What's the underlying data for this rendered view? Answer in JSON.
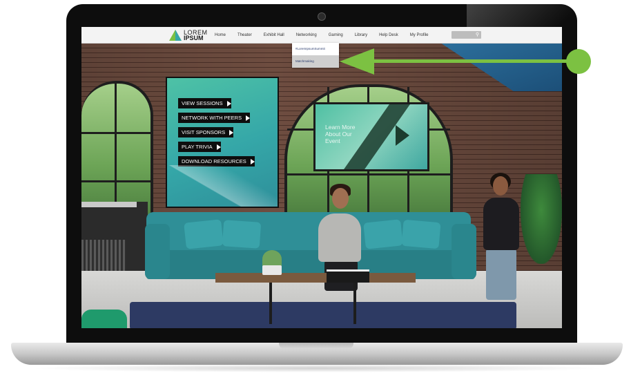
{
  "logo": {
    "line1": "LOREM",
    "line2": "IPSUM"
  },
  "nav": {
    "items": [
      "Home",
      "Theater",
      "Exhibit Hall",
      "Networking",
      "Gaming",
      "Library",
      "Help Desk",
      "My Profile"
    ]
  },
  "search": {
    "icon": "search-icon"
  },
  "dropdown": {
    "items": [
      "#LoremIpsumSummit",
      "Matchmaking"
    ],
    "selected": "Matchmaking"
  },
  "panel": {
    "buttons": [
      "VIEW SESSIONS",
      "NETWORK WITH PEERS",
      "VISIT SPONSORS",
      "PLAY TRIVIA",
      "DOWNLOAD RESOURCES"
    ]
  },
  "tv": {
    "line1": "Learn More",
    "line2": "About Our",
    "line3": "Event"
  },
  "colors": {
    "accent_green": "#7cc142",
    "teal": "#35a7a8",
    "nav_bg": "#f3f3f3"
  }
}
